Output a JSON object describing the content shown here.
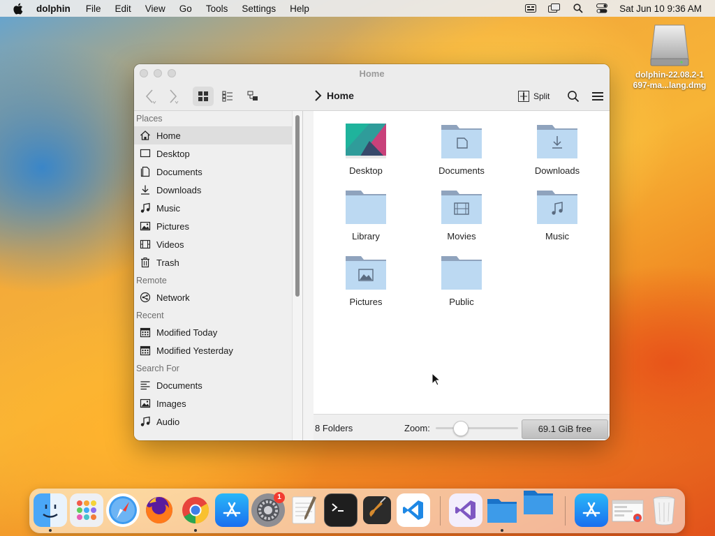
{
  "menubar": {
    "app_name": "dolphin",
    "menus": [
      "File",
      "Edit",
      "View",
      "Go",
      "Tools",
      "Settings",
      "Help"
    ],
    "clock": "Sat Jun 10  9:36 AM",
    "status_icons": [
      "keyboard-input-icon",
      "screen-mirroring-icon",
      "spotlight-search-icon",
      "control-center-icon"
    ]
  },
  "desktop": {
    "disk_label_line1": "dolphin-22.08.2-1",
    "disk_label_line2": "697-ma...lang.dmg"
  },
  "window": {
    "title": "Home",
    "breadcrumb": "Home",
    "split_label": "Split",
    "sidebar": {
      "sections": [
        {
          "title": "Places",
          "items": [
            {
              "label": "Home",
              "icon": "home-icon",
              "selected": true
            },
            {
              "label": "Desktop",
              "icon": "desktop-icon"
            },
            {
              "label": "Documents",
              "icon": "documents-icon"
            },
            {
              "label": "Downloads",
              "icon": "downloads-icon"
            },
            {
              "label": "Music",
              "icon": "music-icon"
            },
            {
              "label": "Pictures",
              "icon": "pictures-icon"
            },
            {
              "label": "Videos",
              "icon": "videos-icon"
            },
            {
              "label": "Trash",
              "icon": "trash-icon"
            }
          ]
        },
        {
          "title": "Remote",
          "items": [
            {
              "label": "Network",
              "icon": "network-icon"
            }
          ]
        },
        {
          "title": "Recent",
          "items": [
            {
              "label": "Modified Today",
              "icon": "calendar-icon"
            },
            {
              "label": "Modified Yesterday",
              "icon": "calendar-icon"
            }
          ]
        },
        {
          "title": "Search For",
          "items": [
            {
              "label": "Documents",
              "icon": "text-lines-icon"
            },
            {
              "label": "Images",
              "icon": "pictures-icon"
            },
            {
              "label": "Audio",
              "icon": "music-icon"
            }
          ]
        }
      ]
    },
    "files": [
      {
        "name": "Desktop",
        "icon": "desktop-wallpaper-icon"
      },
      {
        "name": "Documents",
        "icon": "folder-documents-icon"
      },
      {
        "name": "Downloads",
        "icon": "folder-downloads-icon"
      },
      {
        "name": "Library",
        "icon": "folder-icon"
      },
      {
        "name": "Movies",
        "icon": "folder-movies-icon"
      },
      {
        "name": "Music",
        "icon": "folder-music-icon"
      },
      {
        "name": "Pictures",
        "icon": "folder-pictures-icon"
      },
      {
        "name": "Public",
        "icon": "folder-icon"
      }
    ],
    "status": {
      "count": "8 Folders",
      "zoom_label": "Zoom:",
      "zoom_level": 0.25,
      "free_space": "69.1 GiB free"
    }
  },
  "dock": {
    "apps": [
      {
        "name": "finder-icon",
        "running": true
      },
      {
        "name": "launchpad-icon"
      },
      {
        "name": "safari-icon"
      },
      {
        "name": "firefox-icon"
      },
      {
        "name": "chrome-icon",
        "running": true
      },
      {
        "name": "app-store-icon"
      },
      {
        "name": "system-preferences-icon",
        "badge": "1"
      },
      {
        "name": "textedit-icon"
      },
      {
        "name": "terminal-icon"
      },
      {
        "name": "garageband-icon"
      },
      {
        "name": "vscode-icon"
      },
      {
        "name": "visual-studio-icon"
      },
      {
        "name": "dolphin-folder-icon",
        "running": true
      },
      {
        "name": "folder-stack-icon"
      },
      {
        "name": "app-store-downloads-icon"
      },
      {
        "name": "chrome-window-icon"
      },
      {
        "name": "trash-icon"
      }
    ]
  }
}
